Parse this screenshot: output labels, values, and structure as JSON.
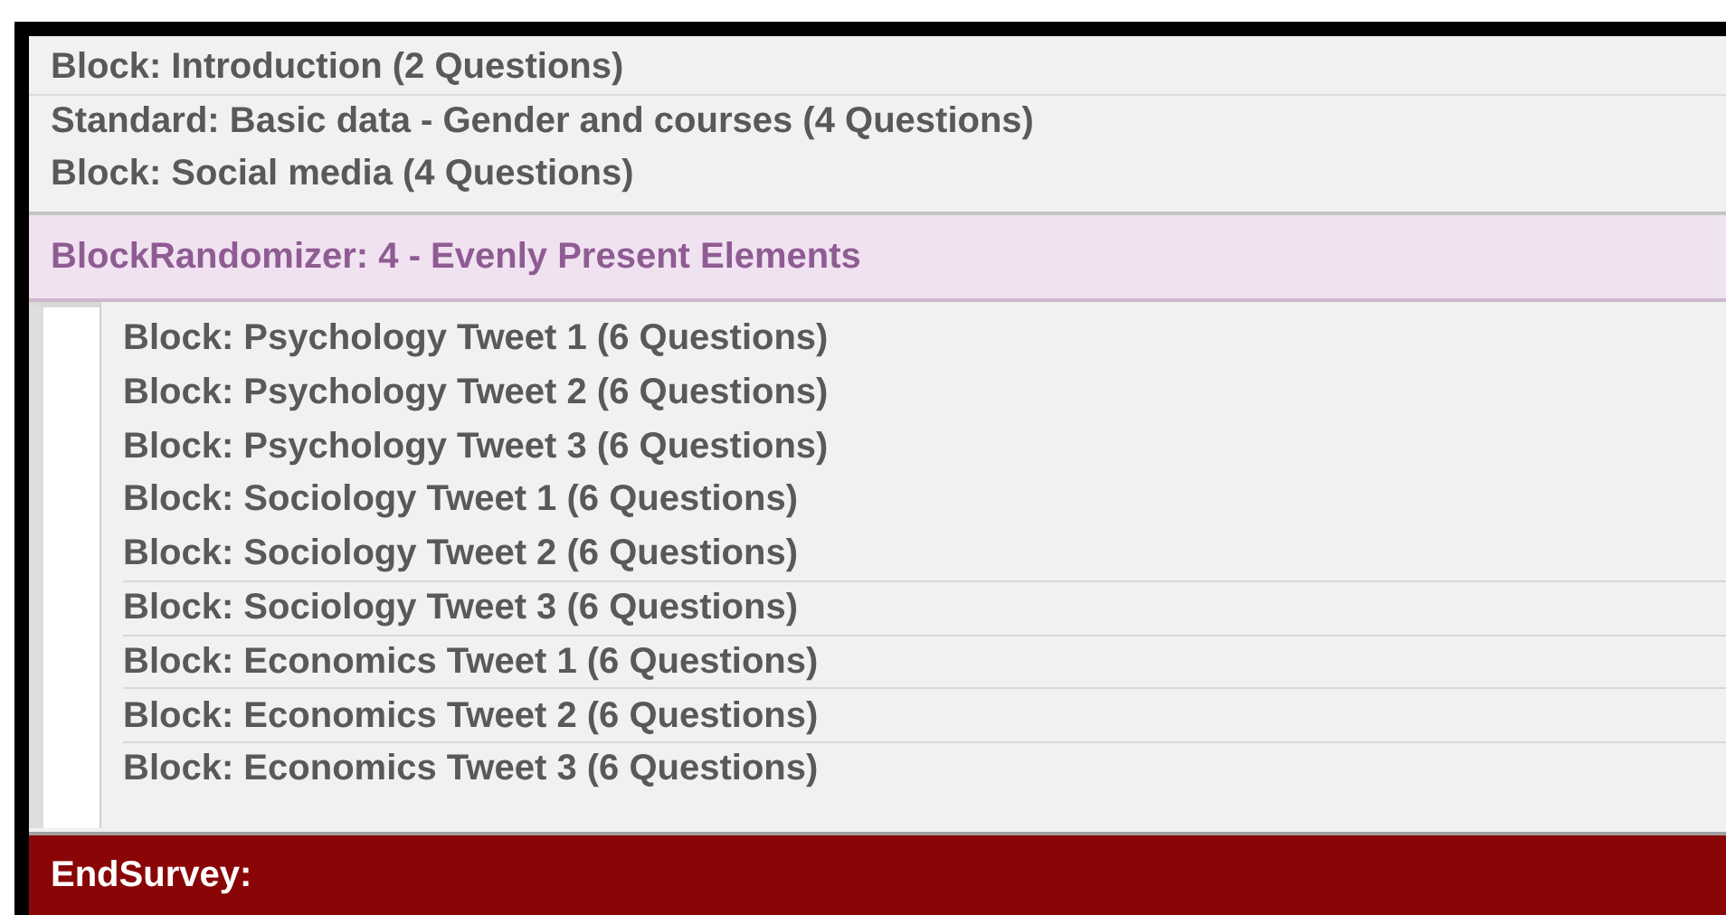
{
  "top_blocks": [
    {
      "label": "Block: Introduction (2 Questions)",
      "divider_above": false
    },
    {
      "label": "Standard: Basic data - Gender and courses (4 Questions)",
      "divider_above": true
    },
    {
      "label": "Block: Social media (4 Questions)",
      "divider_above": false
    }
  ],
  "randomizer": {
    "label": "BlockRandomizer: 4 - Evenly Present Elements",
    "children": [
      {
        "label": "Block: Psychology Tweet 1 (6 Questions)",
        "divider_above": false
      },
      {
        "label": "Block: Psychology Tweet 2 (6 Questions)",
        "divider_above": false
      },
      {
        "label": "Block: Psychology Tweet 3 (6 Questions)",
        "divider_above": false
      },
      {
        "label": "Block: Sociology Tweet 1 (6 Questions)",
        "divider_above": false
      },
      {
        "label": "Block: Sociology Tweet 2 (6 Questions)",
        "divider_above": false
      },
      {
        "label": "Block: Sociology Tweet 3 (6 Questions)",
        "divider_above": true
      },
      {
        "label": "Block: Economics Tweet 1 (6 Questions)",
        "divider_above": true
      },
      {
        "label": "Block: Economics Tweet 2 (6 Questions)",
        "divider_above": true
      },
      {
        "label": "Block: Economics Tweet 3 (6 Questions)",
        "divider_above": true
      }
    ]
  },
  "end_survey": {
    "label": "EndSurvey:"
  }
}
